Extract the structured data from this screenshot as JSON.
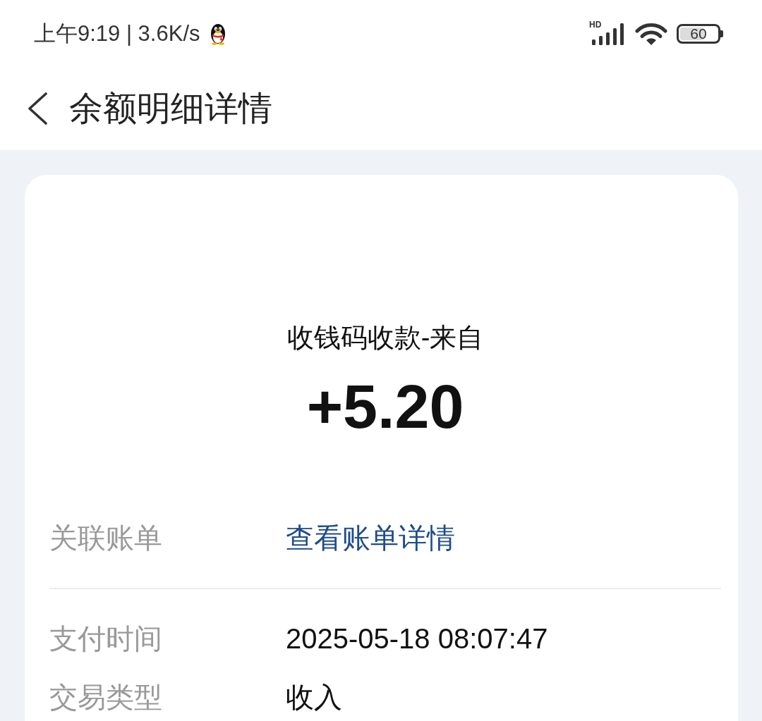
{
  "status_bar": {
    "text": "上午9:19 | 3.6K/s",
    "network_type": "HD",
    "battery": "60"
  },
  "header": {
    "title": "余额明细详情"
  },
  "card": {
    "title": "收钱码收款-来自",
    "amount": "+5.20"
  },
  "sections": [
    {
      "rows": [
        {
          "label": "关联账单",
          "value": "查看账单详情",
          "kind": "link"
        }
      ]
    },
    {
      "rows": [
        {
          "label": "支付时间",
          "value": "2025-05-18 08:07:47",
          "kind": "text"
        },
        {
          "label": "交易类型",
          "value": "收入",
          "kind": "text"
        }
      ]
    }
  ]
}
